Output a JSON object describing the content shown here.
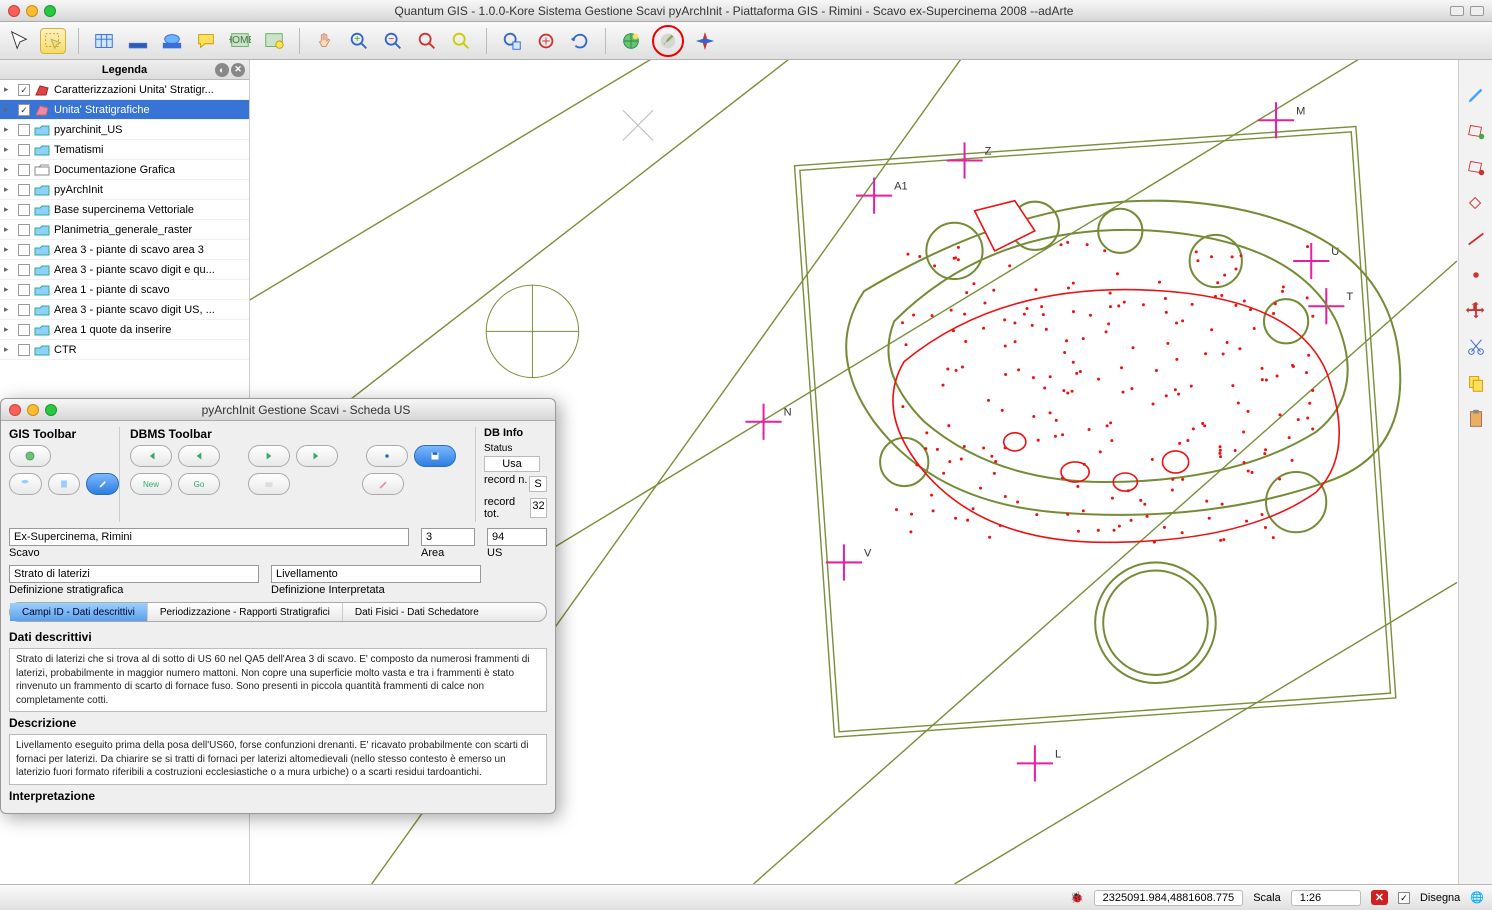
{
  "title": "Quantum GIS - 1.0.0-Kore  Sistema Gestione Scavi pyArchInit - Piattaforma GIS - Rimini - Scavo ex-Supercinema 2008   --adArte",
  "toolbar_icons": [
    "pointer",
    "select-yellow",
    "table",
    "ruler",
    "ruler2",
    "comment",
    "home",
    "home2",
    "hand",
    "zoom-in",
    "zoom-out",
    "zoom-box",
    "zoom-sel",
    "zoom-layer",
    "zoom-full",
    "refresh",
    "world",
    "brush",
    "compass"
  ],
  "legend": {
    "title": "Legenda",
    "layers": [
      {
        "checked": true,
        "name": "Caratterizzazioni Unita' Stratigr...",
        "type": "poly-red",
        "expand": true
      },
      {
        "checked": true,
        "name": "Unita' Stratigrafiche",
        "type": "poly-pink",
        "selected": true,
        "expand": true
      },
      {
        "checked": false,
        "name": "pyarchinit_US",
        "type": "folder",
        "expand": true
      },
      {
        "checked": false,
        "name": "Tematismi",
        "type": "folder",
        "expand": true
      },
      {
        "checked": false,
        "name": "Documentazione Grafica",
        "type": "folder-open",
        "expand": true
      },
      {
        "checked": false,
        "name": "pyArchInit",
        "type": "folder",
        "expand": true
      },
      {
        "checked": false,
        "name": "Base supercinema Vettoriale",
        "type": "folder",
        "expand": true
      },
      {
        "checked": false,
        "name": "Planimetria_generale_raster",
        "type": "folder",
        "expand": true
      },
      {
        "checked": false,
        "name": "Area 3 - piante di scavo area 3",
        "type": "folder",
        "expand": true
      },
      {
        "checked": false,
        "name": "Area 3 - piante scavo digit e qu...",
        "type": "folder",
        "expand": true
      },
      {
        "checked": false,
        "name": "Area 1 - piante di scavo",
        "type": "folder",
        "expand": true
      },
      {
        "checked": false,
        "name": "Area 3 - piante scavo digit  US, ...",
        "type": "folder",
        "expand": true
      },
      {
        "checked": false,
        "name": "Area 1 quote da inserire",
        "type": "folder",
        "expand": true
      },
      {
        "checked": false,
        "name": "CTR",
        "type": "folder",
        "expand": true
      }
    ]
  },
  "right_icons": [
    "pencil",
    "polygon-plus",
    "polygon-del",
    "shape",
    "line",
    "point-red",
    "legend",
    "clipboard"
  ],
  "dialog": {
    "title": "pyArchInit Gestione Scavi - Scheda US",
    "gis_label": "GIS Toolbar",
    "dbms_label": "DBMS Toolbar",
    "dbinfo_label": "DB Info",
    "status_label": "Status",
    "status_value": "Usa",
    "record_n_label": "record n.",
    "record_n": "S",
    "record_tot_label": "record tot.",
    "record_tot": "32",
    "scavo_value": "Ex-Supercinema, Rimini",
    "scavo_label": "Scavo",
    "area_value": "3",
    "area_label": "Area",
    "us_value": "94",
    "us_label": "US",
    "def_strat_value": "Strato di laterizi",
    "def_strat_label": "Definizione stratigrafica",
    "def_interp_value": "Livellamento",
    "def_interp_label": "Definizione Interpretata",
    "tabs": [
      "Campi ID - Dati descrittivi",
      "Periodizzazione - Rapporti Stratigrafici",
      "Dati Fisici - Dati Schedatore"
    ],
    "dati_title": "Dati descrittivi",
    "desc1": "Strato di laterizi che si trova al di sotto di US 60 nel QA5 dell'Area 3 di scavo. E' composto da numerosi frammenti di laterizi, probabilmente in maggior numero mattoni. Non copre una superficie molto vasta e tra i frammenti è stato rinvenuto un frammento di scarto di fornace fuso. Sono presenti in piccola quantità frammenti di calce non completamente cotti.",
    "desc_label": "Descrizione",
    "desc2": "Livellamento eseguito prima della posa dell'US60, forse confunzioni drenanti. E' ricavato probabilmente con scarti di fornaci per laterizi. Da chiarire se si tratti di fornaci per laterizi altomedievali (nello stesso contesto è emerso un laterizio fuori formato riferibili a costruzioni ecclesiastiche o a mura urbiche) o a scarti residui tardoantichi.",
    "interp_label": "Interpretazione"
  },
  "status": {
    "coords": "2325091.984,4881608.775",
    "scala_label": "Scala",
    "scala_value": "1:26",
    "disegna": "Disegna"
  },
  "map_markers": [
    "M",
    "Z",
    "A1",
    "U",
    "T",
    "N",
    "V",
    "L"
  ]
}
